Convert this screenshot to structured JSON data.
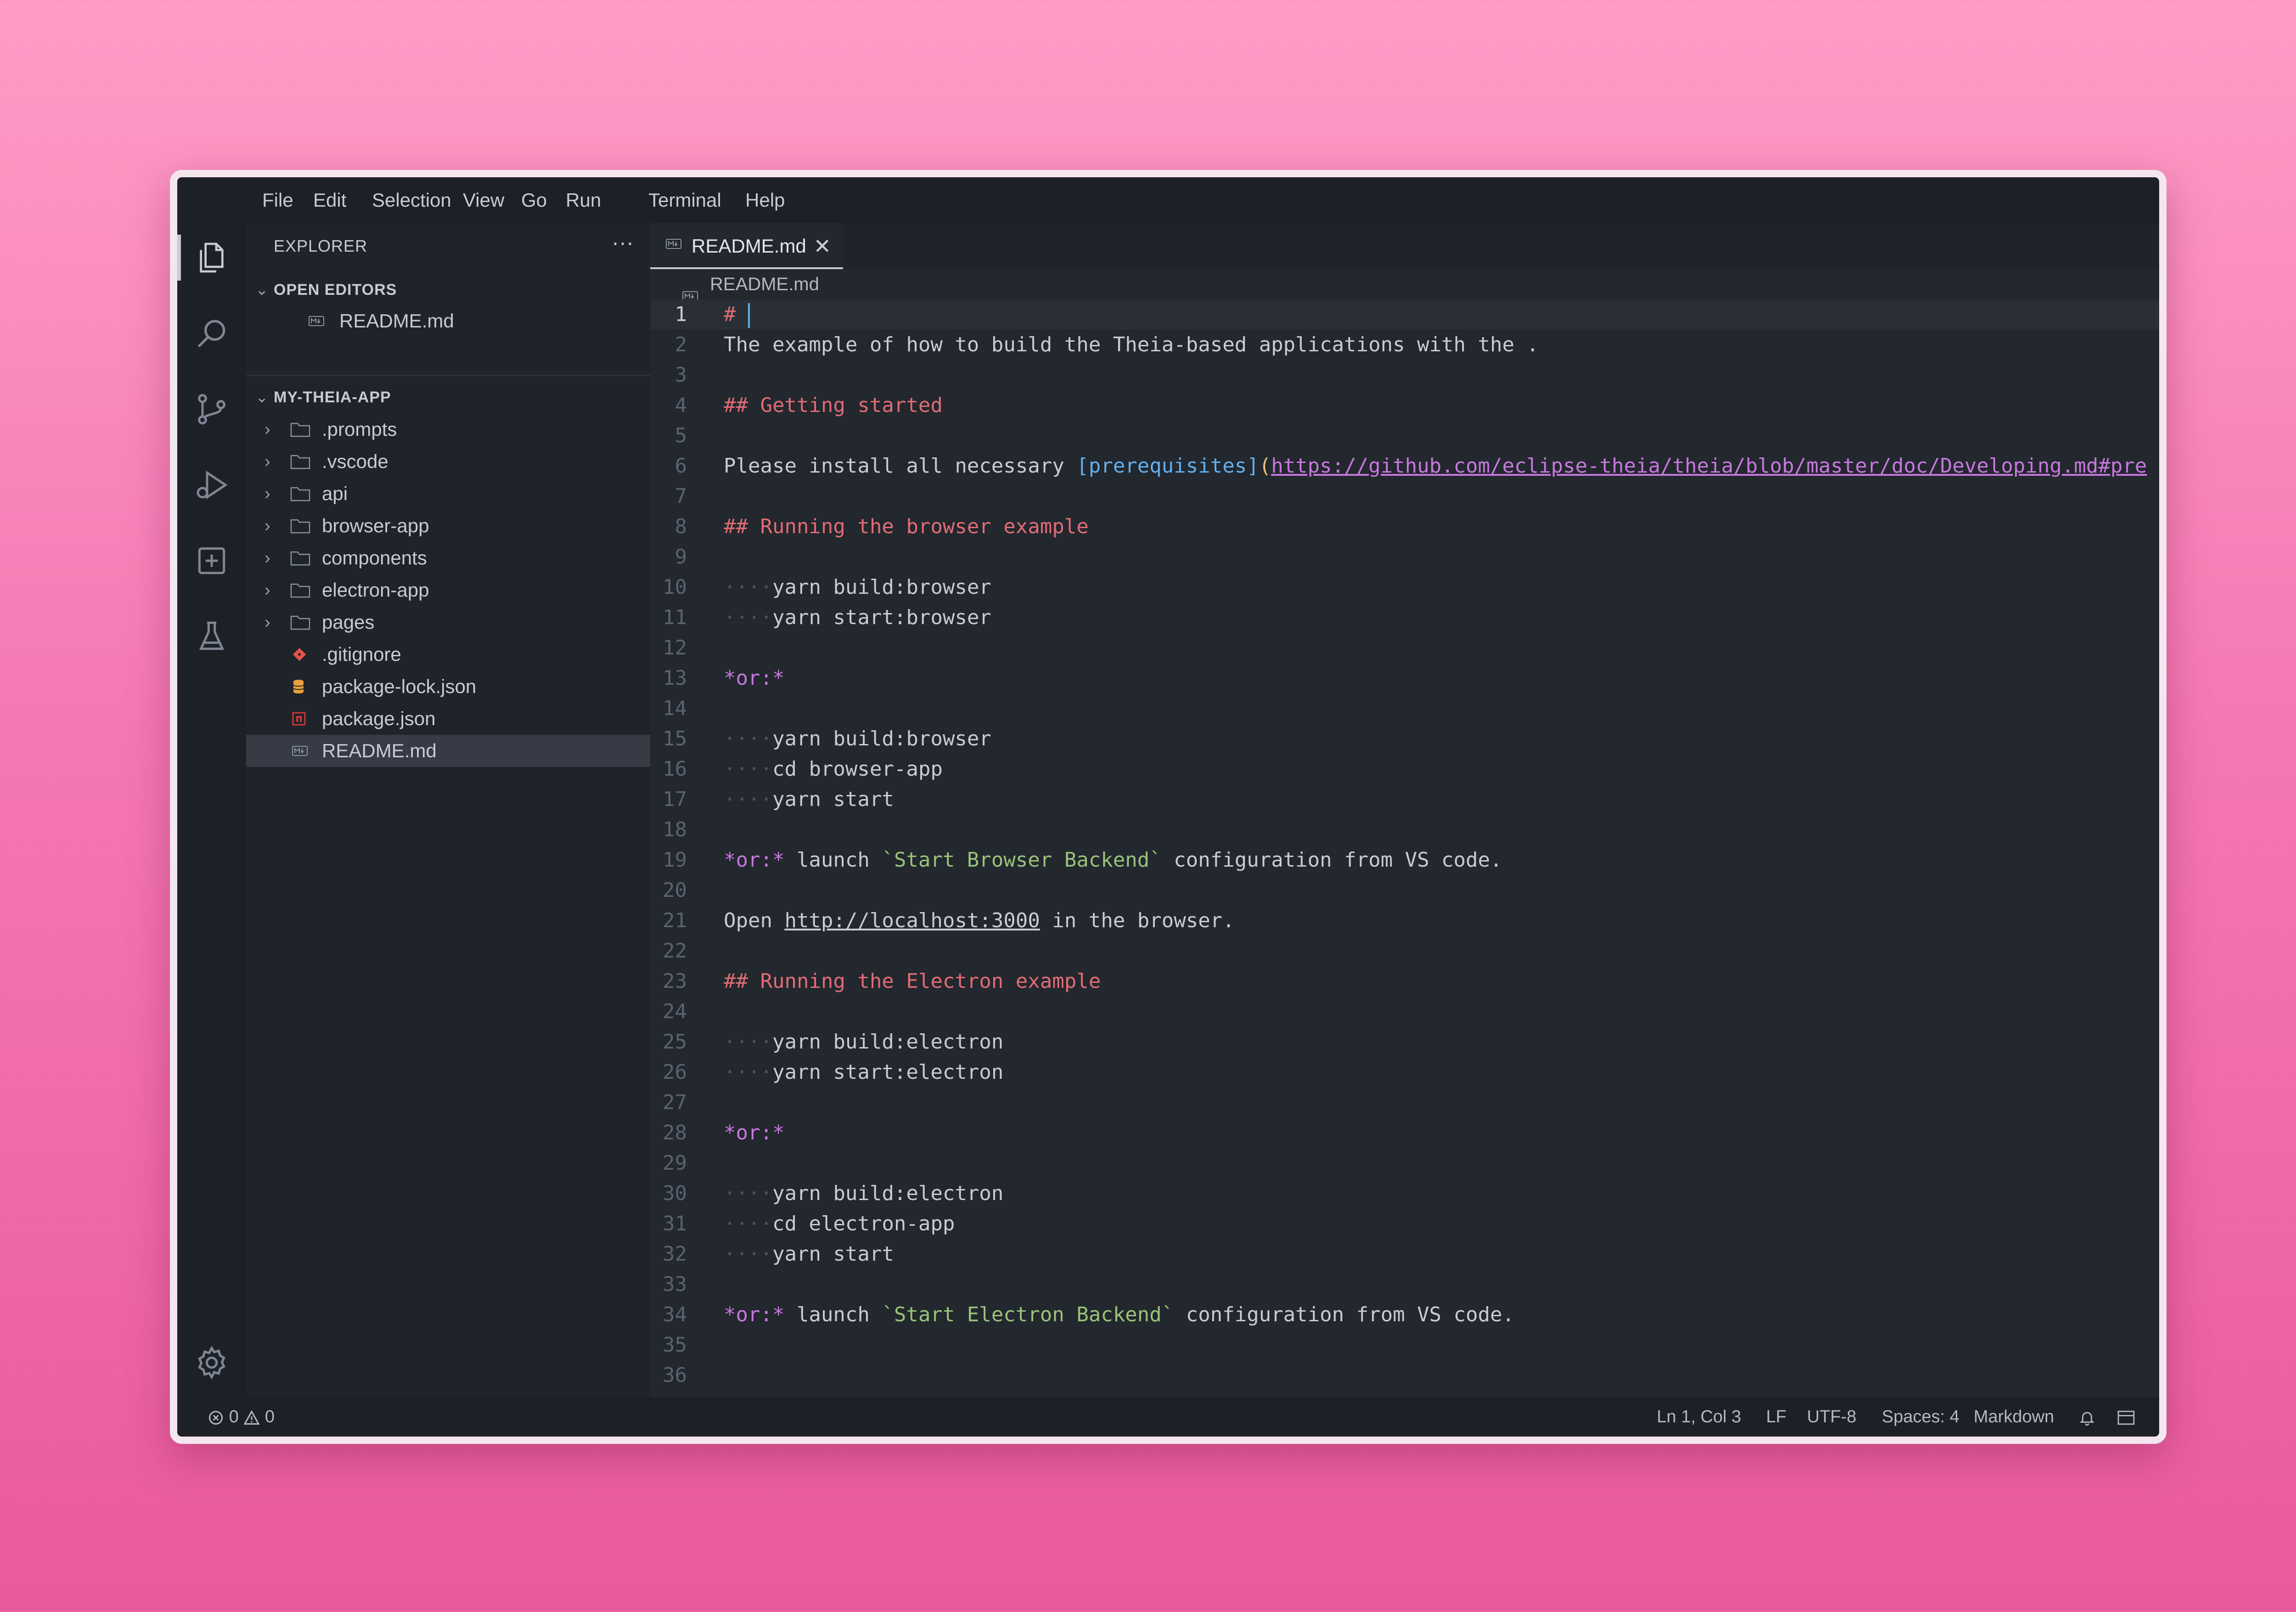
{
  "menubar": {
    "items": [
      "File",
      "Edit",
      "Selection",
      "View",
      "Go",
      "Run",
      "Terminal",
      "Help"
    ]
  },
  "activity_bar": {
    "items": [
      "files-icon",
      "search-icon",
      "source-control-icon",
      "run-debug-icon",
      "extensions-icon",
      "testing-icon"
    ],
    "bottom": "settings-gear-icon"
  },
  "sidebar": {
    "title": "EXPLORER",
    "more": "···",
    "open_editors": {
      "header": "OPEN EDITORS",
      "files": [
        "README.md"
      ]
    },
    "project": {
      "header": "MY-THEIA-APP",
      "folders": [
        ".prompts",
        ".vscode",
        "api",
        "browser-app",
        "components",
        "electron-app",
        "pages"
      ],
      "files": [
        ".gitignore",
        "package-lock.json",
        "package.json",
        "README.md"
      ]
    }
  },
  "editor": {
    "tab": {
      "label": "README.md",
      "close": "✕"
    },
    "breadcrumb": "README.md",
    "lines": [
      "1",
      "2",
      "3",
      "4",
      "5",
      "6",
      "7",
      "8",
      "9",
      "10",
      "11",
      "12",
      "13",
      "14",
      "15",
      "16",
      "17",
      "18",
      "19",
      "20",
      "21",
      "22",
      "23",
      "24",
      "25",
      "26",
      "27",
      "28",
      "29",
      "30",
      "31",
      "32",
      "33",
      "34",
      "35",
      "36"
    ],
    "code": {
      "l1": "# ",
      "l2": "The example of how to build the Theia-based applications with the .",
      "l4": "## Getting started",
      "l6_pre": "Please install all necessary ",
      "l6_link": "[prerequisites]",
      "l6_url": "https://github.com/eclipse-theia/theia/blob/master/doc/Developing.md#pre",
      "l8": "## Running the browser example",
      "l10": "yarn build:browser",
      "l11": "yarn start:browser",
      "l13": "*or:*",
      "l15": "yarn build:browser",
      "l16": "cd browser-app",
      "l17": "yarn start",
      "l19_em": "*or:*",
      "l19_mid": " launch ",
      "l19_code": "`Start Browser Backend`",
      "l19_post": " configuration from VS code.",
      "l21_pre": "Open ",
      "l21_url": "http://localhost:3000",
      "l21_post": " in the browser.",
      "l23": "## Running the Electron example",
      "l25": "yarn build:electron",
      "l26": "yarn start:electron",
      "l28": "*or:*",
      "l30": "yarn build:electron",
      "l31": "cd electron-app",
      "l32": "yarn start",
      "l34_em": "*or:*",
      "l34_mid": " launch ",
      "l34_code": "`Start Electron Backend`",
      "l34_post": " configuration from VS code."
    }
  },
  "status_bar": {
    "errors": "0",
    "warnings": "0",
    "position": "Ln 1, Col 3",
    "eol": "LF",
    "encoding": "UTF-8",
    "indent": "Spaces: 4",
    "language": "Markdown"
  },
  "colors": {
    "background_top": "#fe9cc7",
    "background_bottom": "#e85a9c",
    "editor_bg": "#23272e",
    "heading": "#e06c75",
    "emphasis": "#c678dd",
    "inline_code": "#98c379",
    "link": "#61afef"
  }
}
